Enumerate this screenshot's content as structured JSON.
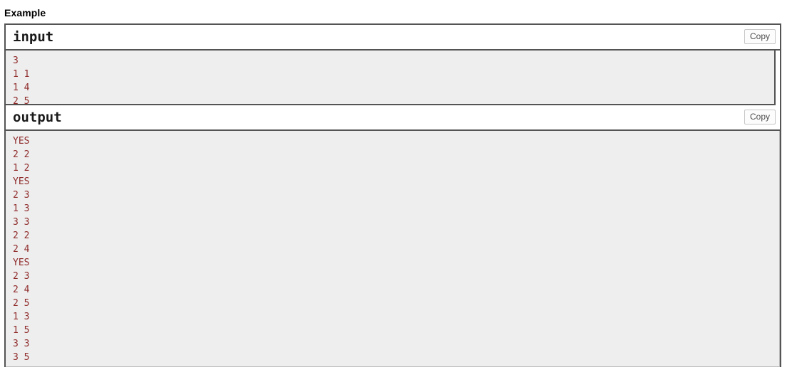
{
  "heading": "Example",
  "colors": {
    "io_text": "#8f2a2a",
    "io_background": "#eeeeee",
    "border": "#545454",
    "copy_border": "#c7c7c7",
    "copy_text": "#4d4d4d"
  },
  "input": {
    "title": "input",
    "copy_label": "Copy",
    "content": "3\n1 1\n1 4\n2 5"
  },
  "output": {
    "title": "output",
    "copy_label": "Copy",
    "content": "YES\n2 2\n1 2\nYES\n2 3\n1 3\n3 3\n2 2\n2 4\nYES\n2 3\n2 4\n2 5\n1 3\n1 5\n3 3\n3 5"
  }
}
